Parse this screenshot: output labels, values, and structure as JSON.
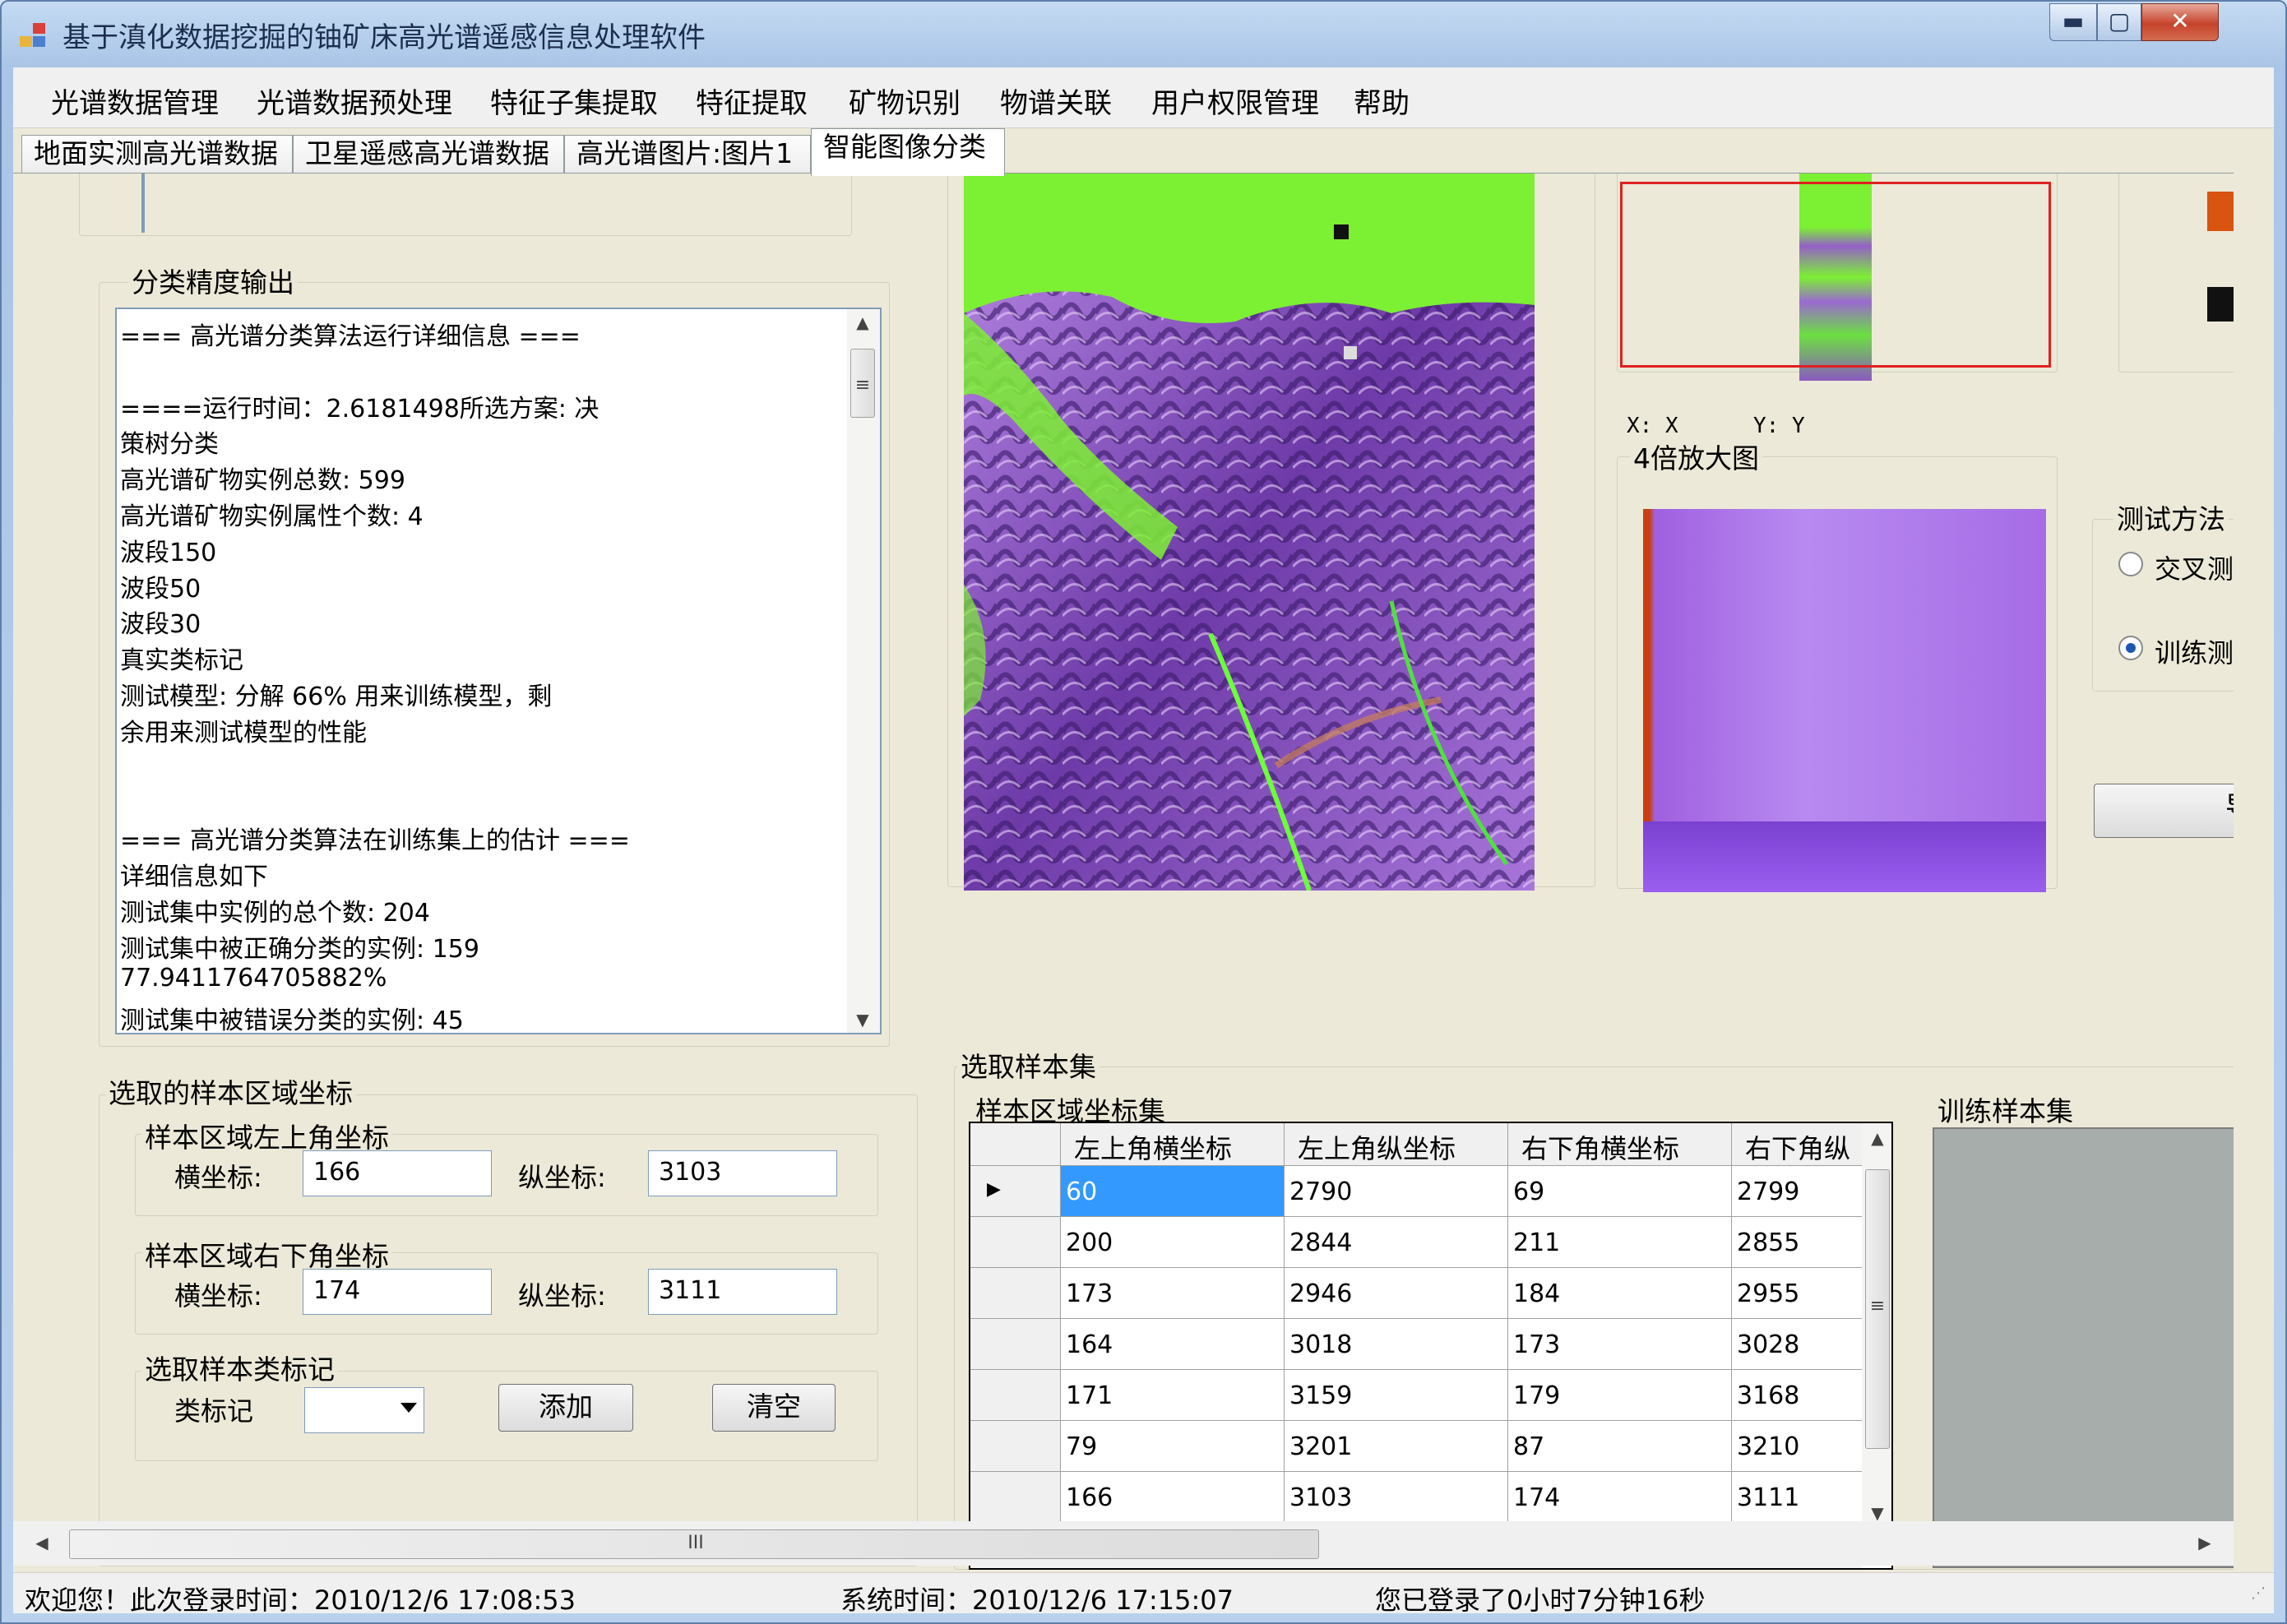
{
  "window": {
    "title": "基于滇化数据挖掘的铀矿床高光谱遥感信息处理软件",
    "controls": {
      "minimize": "▬",
      "maximize": "▢",
      "close": "✕"
    }
  },
  "menu": [
    "光谱数据管理",
    "光谱数据预处理",
    "特征子集提取",
    "特征提取",
    "矿物识别",
    "物谱关联",
    "用户权限管理",
    "帮助"
  ],
  "tabs": [
    "地面实测高光谱数据",
    "卫星遥感高光谱数据",
    "高光谱图片:图片1",
    "智能图像分类"
  ],
  "accuracy": {
    "group_label": "分类精度输出",
    "lines": [
      "=== 高光谱分类算法运行详细信息 ===",
      "",
      "====运行时间：2.6181498所选方案:                    决",
      "策树分类",
      "高光谱矿物实例总数:          599",
      "高光谱矿物实例属性个数:      4",
      "                            波段150",
      "                            波段50",
      "                            波段30",
      "                            真实类标记",
      "测试模型:                   分解 66% 用来训练模型，剩",
      "余用来测试模型的性能",
      "",
      "",
      "=== 高光谱分类算法在训练集上的估计 ===",
      "详细信息如下",
      "测试集中实例的总个数:                      204",
      "测试集中被正确分类的实例:                  159",
      "77.9411764705882%",
      "测试集中被错误分类的实例:                   45"
    ]
  },
  "sample_region": {
    "group_label": "选取的样本区域坐标",
    "top_left": {
      "label": "样本区域左上角坐标",
      "x_label": "横坐标:",
      "x": "166",
      "y_label": "纵坐标:",
      "y": "3103"
    },
    "bottom_right": {
      "label": "样本区域右下角坐标",
      "x_label": "横坐标:",
      "x": "174",
      "y_label": "纵坐标:",
      "y": "3111"
    },
    "class_mark": {
      "label": "选取样本类标记",
      "field_label": "类标记",
      "add": "添加",
      "clear": "清空"
    }
  },
  "preview": {
    "coord_x": "X: X",
    "coord_y": "Y: Y",
    "zoom_label": "4倍放大图"
  },
  "test_method": {
    "label": "测试方法",
    "options": [
      "交叉测",
      "训练测"
    ],
    "selected": 1,
    "button": "导"
  },
  "sample_set": {
    "group_label": "选取样本集",
    "coords_label": "样本区域坐标集",
    "train_label": "训练样本集",
    "columns": [
      "左上角横坐标",
      "左上角纵坐标",
      "右下角横坐标",
      "右下角纵"
    ],
    "rows": [
      [
        "60",
        "2790",
        "69",
        "2799"
      ],
      [
        "200",
        "2844",
        "211",
        "2855"
      ],
      [
        "173",
        "2946",
        "184",
        "2955"
      ],
      [
        "164",
        "3018",
        "173",
        "3028"
      ],
      [
        "171",
        "3159",
        "179",
        "3168"
      ],
      [
        "79",
        "3201",
        "87",
        "3210"
      ],
      [
        "166",
        "3103",
        "174",
        "3111"
      ]
    ]
  },
  "scroll": {
    "h_mid": "III",
    "v_mid": "≡"
  },
  "status": {
    "welcome": "欢迎您！此次登录时间：2010/12/6 17:08:53",
    "system_time": "系统时间：2010/12/6 17:15:07",
    "duration": "您已登录了0小时7分钟16秒"
  },
  "colors": {
    "accent_red": "#e02020",
    "swatch_orange": "#d9540f",
    "swatch_black": "#111111",
    "selection": "#3399ff"
  }
}
